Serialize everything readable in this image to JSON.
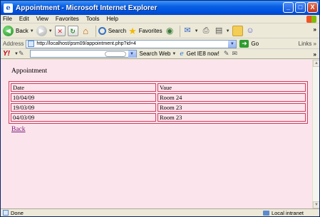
{
  "window": {
    "title": "Appointment - Microsoft Internet Explorer",
    "minimize": "_",
    "maximize": "□",
    "close": "X"
  },
  "menu": [
    "File",
    "Edit",
    "View",
    "Favorites",
    "Tools",
    "Help"
  ],
  "toolbar": {
    "back": "Back",
    "search": "Search",
    "favorites": "Favorites"
  },
  "address": {
    "label": "Address",
    "url": "http://localhost/psm09/appointment.php?id=4",
    "go": "Go",
    "links": "Links"
  },
  "yahoo": {
    "search_web": "Search Web",
    "get_ie8": "Get IE8 now!"
  },
  "page": {
    "heading": "Appointment",
    "table": {
      "headers": [
        "Date",
        "Vaue"
      ],
      "rows": [
        [
          "10/04/09",
          "Room 24"
        ],
        [
          "19/03/09",
          "Room 23"
        ],
        [
          "04/03/09",
          "Room 23"
        ]
      ]
    },
    "back_link": "Back"
  },
  "status": {
    "text": "Done",
    "zone": "Local intranet"
  },
  "colors": {
    "page_background": "#fce4ec",
    "table_border": "#d04060",
    "visited_link": "#7a1d7a",
    "titlebar": "#0054e3"
  },
  "icons": [
    "ie-logo-icon",
    "back-arrow-icon",
    "forward-arrow-icon",
    "stop-icon",
    "refresh-icon",
    "home-icon",
    "search-icon",
    "favorites-star-icon",
    "media-icon",
    "mail-icon",
    "print-icon",
    "folder-icon",
    "messenger-icon",
    "page-icon",
    "go-arrow-icon",
    "yahoo-logo-icon",
    "pencil-icon",
    "ie8-icon",
    "intranet-icon"
  ]
}
